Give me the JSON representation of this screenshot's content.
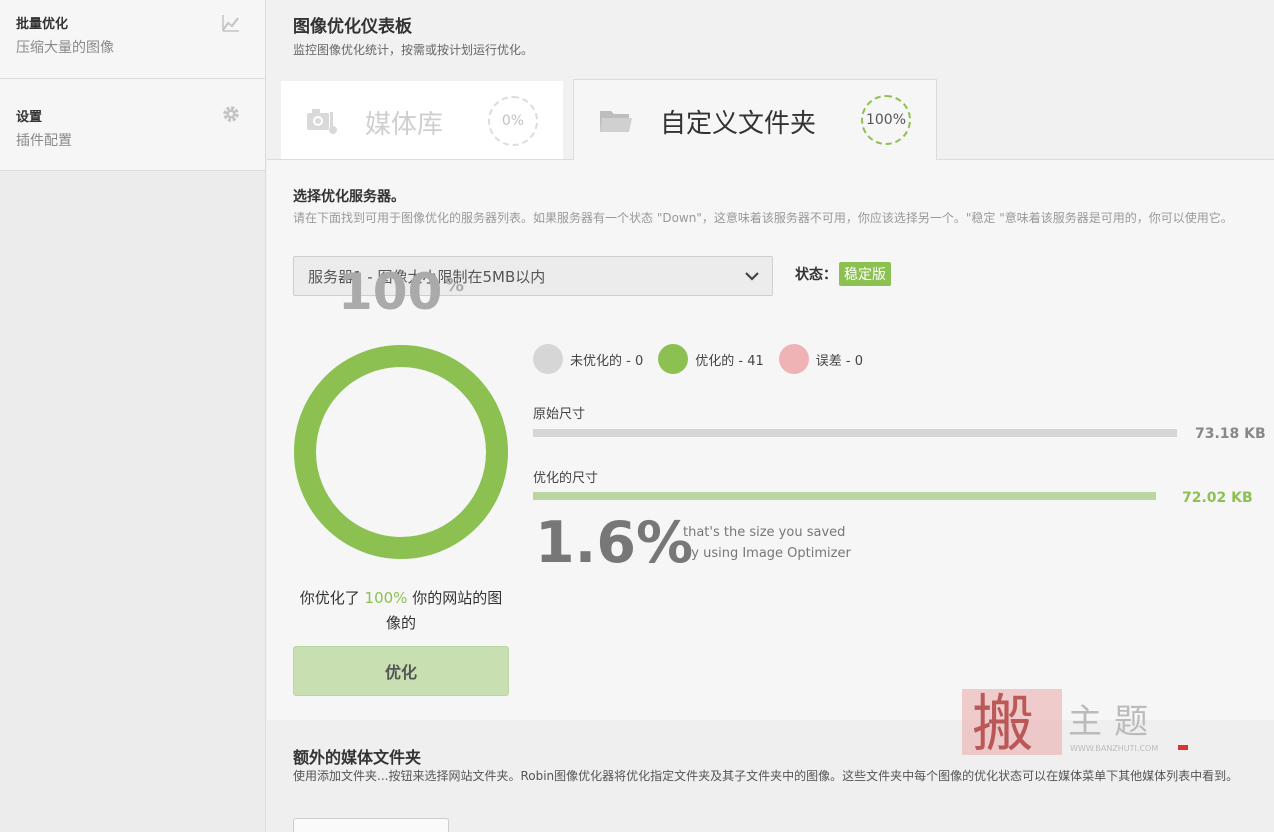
{
  "sidebar": {
    "items": [
      {
        "title": "批量优化",
        "subtitle": "压缩大量的图像",
        "icon": "chart-icon"
      },
      {
        "title": "设置",
        "subtitle": "插件配置",
        "icon": "gear-icon"
      }
    ]
  },
  "header": {
    "title": "图像优化仪表板",
    "description": "监控图像优化统计，按需或按计划运行优化。"
  },
  "tabs": [
    {
      "label": "媒体库",
      "percent": "0%",
      "icon": "camera-icon"
    },
    {
      "label": "自定义文件夹",
      "percent": "100%",
      "icon": "folder-icon"
    }
  ],
  "server": {
    "title": "选择优化服务器。",
    "description": "请在下面找到可用于图像优化的服务器列表。如果服务器有一个状态 \"Down\"，这意味着该服务器不可用，你应该选择另一个。\"稳定 \"意味着该服务器是可用的，你可以使用它。",
    "selected": "服务器1 - 图像大小限制在5MB以内",
    "status_label": "状态：",
    "status_value": "稳定版"
  },
  "summary": {
    "percent_value": "100",
    "percent_unit": "%",
    "percent_fraction": 1.0,
    "text_before": "你优化了 ",
    "text_highlight": "100%",
    "text_after": " 你的网站的图像的",
    "button_label": "优化"
  },
  "legend": [
    {
      "label": "未优化的 - 0",
      "color": "#d6d6d6"
    },
    {
      "label": "优化的 - 41",
      "color": "#8cc152"
    },
    {
      "label": "误差 - 0",
      "color": "#f0b3b5"
    }
  ],
  "sizes": {
    "original_label": "原始尺寸",
    "original_value": "73.18 KB",
    "original_kb": 73.18,
    "optimized_label": "优化的尺寸",
    "optimized_value": "72.02 KB",
    "optimized_kb": 72.02
  },
  "saved": {
    "percent": "1.6%",
    "note_line1": "that's the size you saved",
    "note_line2": "by using Image Optimizer"
  },
  "extra": {
    "title": "额外的媒体文件夹",
    "description": "使用添加文件夹...按钮来选择网站文件夹。Robin图像优化器将优化指定文件夹及其子文件夹中的图像。这些文件夹中每个图像的优化状态可以在媒体菜单下其他媒体列表中看到。"
  },
  "watermark": {
    "text": "主题",
    "url": "WWW.BANZHUTI.COM"
  },
  "colors": {
    "accent": "#8cc152",
    "bar_original": "#d6d6d6",
    "bar_optimized": "#bcd6a2"
  }
}
